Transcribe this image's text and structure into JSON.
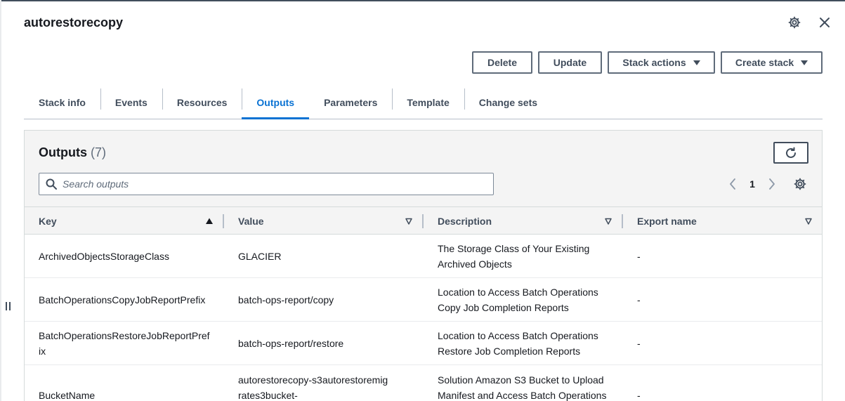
{
  "stack": {
    "name": "autorestorecopy"
  },
  "top_icons": {
    "settings": "gear-icon",
    "close": "close-icon"
  },
  "actions": {
    "delete": "Delete",
    "update": "Update",
    "stack_actions": "Stack actions",
    "create_stack": "Create stack"
  },
  "tabs": [
    {
      "label": "Stack info",
      "active": false
    },
    {
      "label": "Events",
      "active": false
    },
    {
      "label": "Resources",
      "active": false
    },
    {
      "label": "Outputs",
      "active": true
    },
    {
      "label": "Parameters",
      "active": false
    },
    {
      "label": "Template",
      "active": false
    },
    {
      "label": "Change sets",
      "active": false
    }
  ],
  "outputs": {
    "title": "Outputs",
    "count": "(7)",
    "search_placeholder": "Search outputs",
    "search_value": "",
    "page": "1",
    "columns": {
      "key": "Key",
      "value": "Value",
      "description": "Description",
      "export_name": "Export name"
    },
    "rows": [
      {
        "key": "ArchivedObjectsStorageClass",
        "value": "GLACIER",
        "description": "The Storage Class of Your Existing Archived Objects",
        "export": "-"
      },
      {
        "key": "BatchOperationsCopyJobReportPrefix",
        "value": "batch-ops-report/copy",
        "description": "Location to Access Batch Operations Copy Job Completion Reports",
        "export": "-"
      },
      {
        "key": "BatchOperationsRestoreJobReportPrefix",
        "value": "batch-ops-report/restore",
        "description": "Location to Access Batch Operations Restore Job Completion Reports",
        "export": "-"
      },
      {
        "key": "BucketName",
        "value": "autorestorecopy-s3autorestoremigrates3bucket-",
        "description": "Solution Amazon S3 Bucket to Upload Manifest and Access Batch Operations",
        "export": "-"
      }
    ]
  },
  "colors": {
    "accent": "#0972d3",
    "text": "#16191f",
    "muted": "#5f6b7a"
  }
}
